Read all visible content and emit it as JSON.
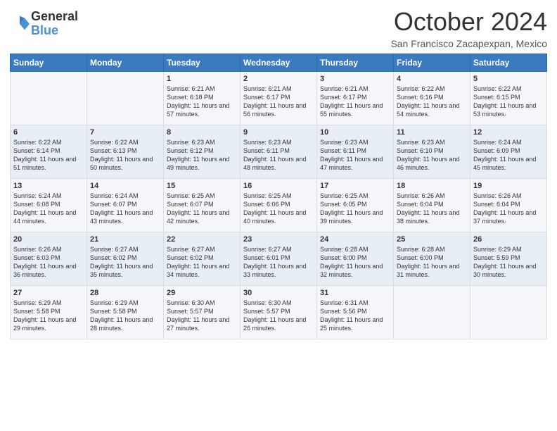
{
  "logo": {
    "general": "General",
    "blue": "Blue"
  },
  "title": "October 2024",
  "location": "San Francisco Zacapexpan, Mexico",
  "days_of_week": [
    "Sunday",
    "Monday",
    "Tuesday",
    "Wednesday",
    "Thursday",
    "Friday",
    "Saturday"
  ],
  "weeks": [
    [
      {
        "day": "",
        "info": ""
      },
      {
        "day": "",
        "info": ""
      },
      {
        "day": "1",
        "info": "Sunrise: 6:21 AM\nSunset: 6:18 PM\nDaylight: 11 hours and 57 minutes."
      },
      {
        "day": "2",
        "info": "Sunrise: 6:21 AM\nSunset: 6:17 PM\nDaylight: 11 hours and 56 minutes."
      },
      {
        "day": "3",
        "info": "Sunrise: 6:21 AM\nSunset: 6:17 PM\nDaylight: 11 hours and 55 minutes."
      },
      {
        "day": "4",
        "info": "Sunrise: 6:22 AM\nSunset: 6:16 PM\nDaylight: 11 hours and 54 minutes."
      },
      {
        "day": "5",
        "info": "Sunrise: 6:22 AM\nSunset: 6:15 PM\nDaylight: 11 hours and 53 minutes."
      }
    ],
    [
      {
        "day": "6",
        "info": "Sunrise: 6:22 AM\nSunset: 6:14 PM\nDaylight: 11 hours and 51 minutes."
      },
      {
        "day": "7",
        "info": "Sunrise: 6:22 AM\nSunset: 6:13 PM\nDaylight: 11 hours and 50 minutes."
      },
      {
        "day": "8",
        "info": "Sunrise: 6:23 AM\nSunset: 6:12 PM\nDaylight: 11 hours and 49 minutes."
      },
      {
        "day": "9",
        "info": "Sunrise: 6:23 AM\nSunset: 6:11 PM\nDaylight: 11 hours and 48 minutes."
      },
      {
        "day": "10",
        "info": "Sunrise: 6:23 AM\nSunset: 6:11 PM\nDaylight: 11 hours and 47 minutes."
      },
      {
        "day": "11",
        "info": "Sunrise: 6:23 AM\nSunset: 6:10 PM\nDaylight: 11 hours and 46 minutes."
      },
      {
        "day": "12",
        "info": "Sunrise: 6:24 AM\nSunset: 6:09 PM\nDaylight: 11 hours and 45 minutes."
      }
    ],
    [
      {
        "day": "13",
        "info": "Sunrise: 6:24 AM\nSunset: 6:08 PM\nDaylight: 11 hours and 44 minutes."
      },
      {
        "day": "14",
        "info": "Sunrise: 6:24 AM\nSunset: 6:07 PM\nDaylight: 11 hours and 43 minutes."
      },
      {
        "day": "15",
        "info": "Sunrise: 6:25 AM\nSunset: 6:07 PM\nDaylight: 11 hours and 42 minutes."
      },
      {
        "day": "16",
        "info": "Sunrise: 6:25 AM\nSunset: 6:06 PM\nDaylight: 11 hours and 40 minutes."
      },
      {
        "day": "17",
        "info": "Sunrise: 6:25 AM\nSunset: 6:05 PM\nDaylight: 11 hours and 39 minutes."
      },
      {
        "day": "18",
        "info": "Sunrise: 6:26 AM\nSunset: 6:04 PM\nDaylight: 11 hours and 38 minutes."
      },
      {
        "day": "19",
        "info": "Sunrise: 6:26 AM\nSunset: 6:04 PM\nDaylight: 11 hours and 37 minutes."
      }
    ],
    [
      {
        "day": "20",
        "info": "Sunrise: 6:26 AM\nSunset: 6:03 PM\nDaylight: 11 hours and 36 minutes."
      },
      {
        "day": "21",
        "info": "Sunrise: 6:27 AM\nSunset: 6:02 PM\nDaylight: 11 hours and 35 minutes."
      },
      {
        "day": "22",
        "info": "Sunrise: 6:27 AM\nSunset: 6:02 PM\nDaylight: 11 hours and 34 minutes."
      },
      {
        "day": "23",
        "info": "Sunrise: 6:27 AM\nSunset: 6:01 PM\nDaylight: 11 hours and 33 minutes."
      },
      {
        "day": "24",
        "info": "Sunrise: 6:28 AM\nSunset: 6:00 PM\nDaylight: 11 hours and 32 minutes."
      },
      {
        "day": "25",
        "info": "Sunrise: 6:28 AM\nSunset: 6:00 PM\nDaylight: 11 hours and 31 minutes."
      },
      {
        "day": "26",
        "info": "Sunrise: 6:29 AM\nSunset: 5:59 PM\nDaylight: 11 hours and 30 minutes."
      }
    ],
    [
      {
        "day": "27",
        "info": "Sunrise: 6:29 AM\nSunset: 5:58 PM\nDaylight: 11 hours and 29 minutes."
      },
      {
        "day": "28",
        "info": "Sunrise: 6:29 AM\nSunset: 5:58 PM\nDaylight: 11 hours and 28 minutes."
      },
      {
        "day": "29",
        "info": "Sunrise: 6:30 AM\nSunset: 5:57 PM\nDaylight: 11 hours and 27 minutes."
      },
      {
        "day": "30",
        "info": "Sunrise: 6:30 AM\nSunset: 5:57 PM\nDaylight: 11 hours and 26 minutes."
      },
      {
        "day": "31",
        "info": "Sunrise: 6:31 AM\nSunset: 5:56 PM\nDaylight: 11 hours and 25 minutes."
      },
      {
        "day": "",
        "info": ""
      },
      {
        "day": "",
        "info": ""
      }
    ]
  ]
}
